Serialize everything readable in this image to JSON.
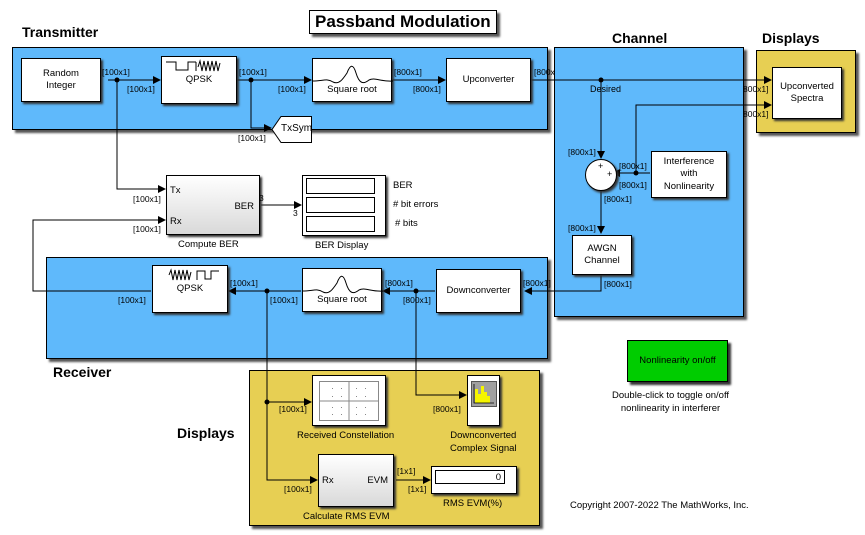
{
  "title": "Passband Modulation",
  "areas": {
    "transmitter": "Transmitter",
    "channel": "Channel",
    "displays_top": "Displays",
    "receiver": "Receiver",
    "displays_bottom": "Displays"
  },
  "blocks": {
    "random_integer": "Random\nInteger",
    "qpsk_mod": "QPSK",
    "tx_square_root": "Square root",
    "upconverter": "Upconverter",
    "txsym_goto": "TxSym",
    "compute_ber": "Compute BER",
    "compute_ber_ports": {
      "tx": "Tx",
      "rx": "Rx",
      "ber": "BER"
    },
    "ber_display": "BER Display",
    "ber_display_rows": [
      "BER",
      "# bit errors",
      "# bits"
    ],
    "upconverted_spectra": "Upconverted\nSpectra",
    "sum_signs": [
      "+",
      "+"
    ],
    "desired_label": "Desired",
    "interference": "Interference\nwith\nNonlinearity",
    "awgn": "AWGN\nChannel",
    "downconverter": "Downconverter",
    "rx_square_root": "Square root",
    "qpsk_demod": "QPSK",
    "received_constellation": "Received Constellation",
    "downconverted_signal": "Downconverted\nComplex Signal",
    "calc_rms_evm": "Calculate RMS EVM",
    "calc_rms_evm_ports": {
      "rx": "Rx",
      "evm": "EVM"
    },
    "rms_evm_display": "RMS EVM(%)",
    "rms_evm_value": "0",
    "nonlinearity_toggle": "Nonlinearity on/off"
  },
  "signals": {
    "s100": "[100x1]",
    "s800": "[800x1]",
    "s1": "[1x1]",
    "s3": "3",
    "s800_trunc": "[800x",
    "s800_trunc2": "800x1]"
  },
  "annotations": {
    "toggle_help": "Double-click to toggle on/off\nnonlinearity in interferer",
    "copyright": "Copyright 2007-2022 The MathWorks, Inc."
  },
  "colors": {
    "subsystem_area": "#5fb9fb",
    "display_area": "#e7cf53",
    "toggle_button": "#00cc00"
  }
}
